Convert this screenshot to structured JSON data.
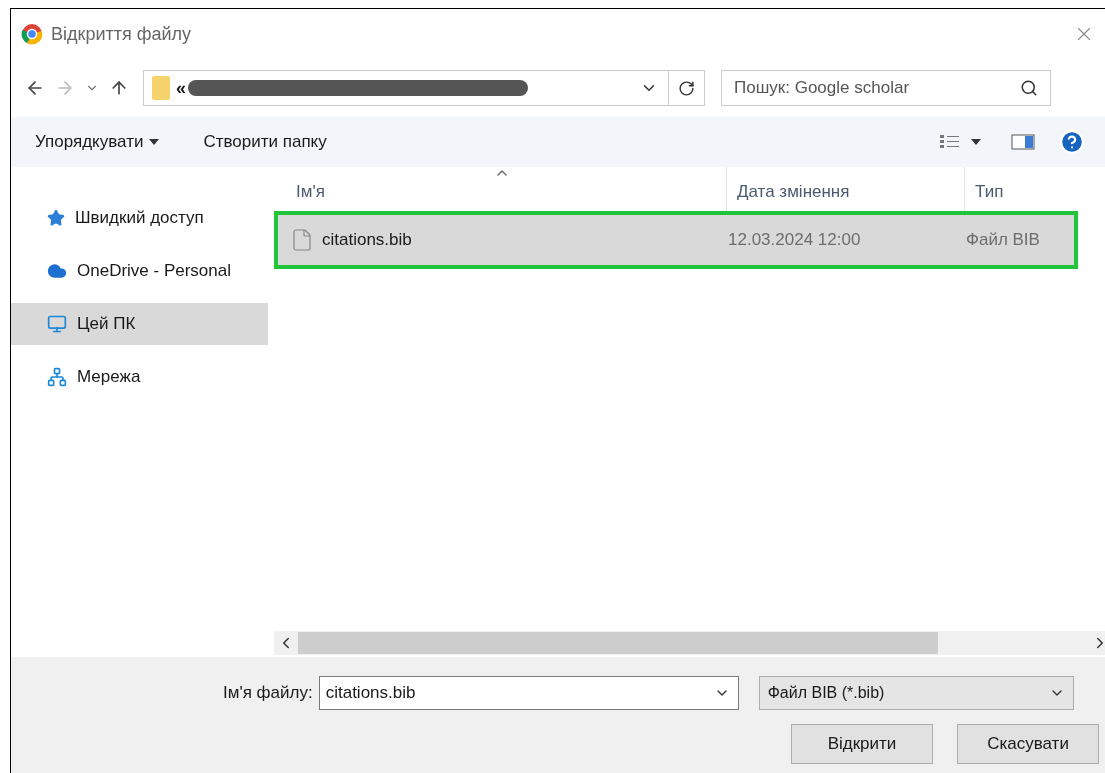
{
  "window": {
    "title": "Відкриття файлу"
  },
  "address": {
    "prefix": "«"
  },
  "search": {
    "placeholder": "Пошук: Google scholar"
  },
  "toolbar": {
    "organize": "Упорядкувати",
    "new_folder": "Створити папку"
  },
  "sidebar": {
    "items": [
      {
        "label": "Швидкий доступ",
        "kind": "quick",
        "selected": false
      },
      {
        "label": "OneDrive - Personal",
        "kind": "cloud",
        "selected": false
      },
      {
        "label": "Цей ПК",
        "kind": "pc",
        "selected": true
      },
      {
        "label": "Мережа",
        "kind": "network",
        "selected": false
      }
    ]
  },
  "table": {
    "columns": [
      "Ім'я",
      "Дата змінення",
      "Тип"
    ],
    "rows": [
      {
        "name": "citations.bib",
        "date": "12.03.2024 12:00",
        "type": "Файл BIB",
        "selected": true,
        "highlighted": true
      }
    ]
  },
  "filename": {
    "label": "Ім'я файлу:",
    "value": "citations.bib"
  },
  "filetype": {
    "value": "Файл BIB (*.bib)"
  },
  "buttons": [
    "Відкрити",
    "Скасувати"
  ]
}
